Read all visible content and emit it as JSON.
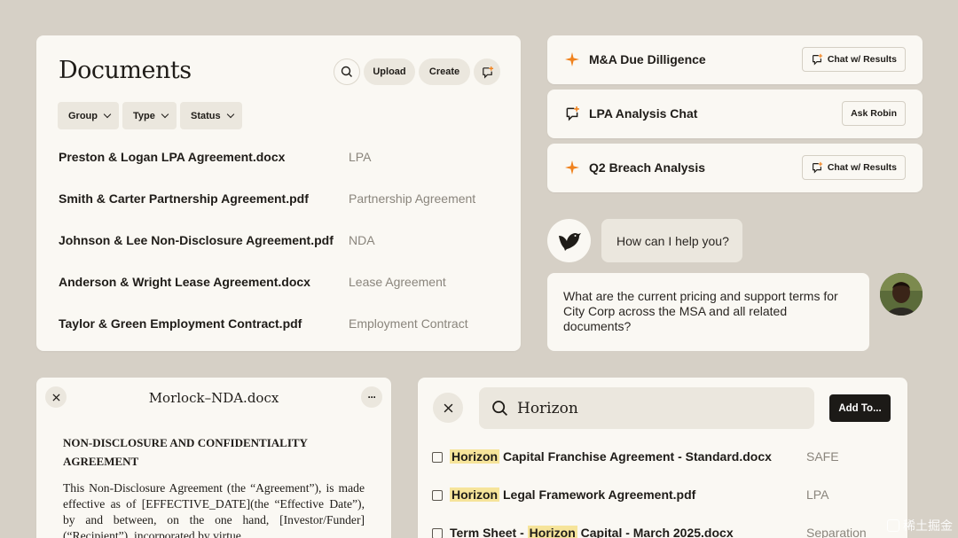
{
  "documents": {
    "title": "Documents",
    "upload_label": "Upload",
    "create_label": "Create",
    "filters": [
      "Group",
      "Type",
      "Status"
    ],
    "rows": [
      {
        "name": "Preston & Logan LPA Agreement.docx",
        "type": "LPA"
      },
      {
        "name": "Smith & Carter Partnership Agreement.pdf",
        "type": "Partnership Agreement"
      },
      {
        "name": "Johnson & Lee Non-Disclosure Agreement.pdf",
        "type": "NDA"
      },
      {
        "name": "Anderson & Wright Lease Agreement.docx",
        "type": "Lease Agreement"
      },
      {
        "name": "Taylor & Green Employment Contract.pdf",
        "type": "Employment Contract"
      }
    ]
  },
  "results": [
    {
      "label": "M&A Due Dilligence",
      "icon": "sparkle-icon",
      "button": "Chat w/ Results"
    },
    {
      "label": "LPA Analysis Chat",
      "icon": "chat-plus-icon",
      "button": "Ask Robin"
    },
    {
      "label": "Q2 Breach Analysis",
      "icon": "sparkle-icon",
      "button": "Chat w/ Results"
    }
  ],
  "chat": {
    "bot_message": "How can I help you?",
    "user_message": "What are the current pricing and support terms for City Corp across the MSA and all related documents?"
  },
  "nda": {
    "title": "Morlock–NDA.docx",
    "heading": "NON-DISCLOSURE AND CONFIDENTIALITY AGREEMENT",
    "body": "This Non-Disclosure Agreement (the “Agreement”), is made effective as of [EFFECTIVE_DATE](the “Effective Date”), by and between, on the one hand, [Investor/Funder] (“Recipient”), incorporated by virtue"
  },
  "search": {
    "query": "Horizon",
    "add_label": "Add To...",
    "results": [
      {
        "pre": "",
        "hl": "Horizon",
        "post": " Capital Franchise Agreement - Standard.docx",
        "type": "SAFE"
      },
      {
        "pre": "",
        "hl": "Horizon",
        "post": " Legal Framework Agreement.pdf",
        "type": "LPA"
      },
      {
        "pre": "Term Sheet - ",
        "hl": "Horizon",
        "post": " Capital - March 2025.docx",
        "type": "Separation"
      }
    ]
  },
  "watermark": "稀土掘金",
  "colors": {
    "accent": "#f0821e",
    "highlight": "#f6e49a",
    "background": "#d6d0c6",
    "card": "#faf8f3"
  }
}
